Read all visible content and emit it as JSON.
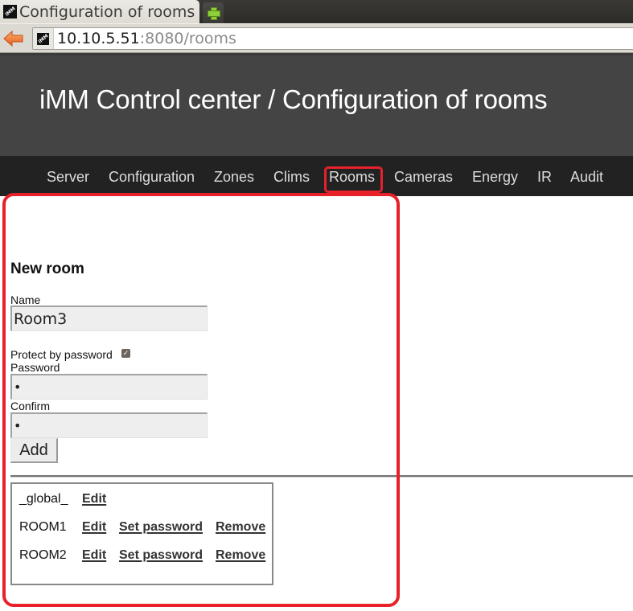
{
  "browser": {
    "tab_title": "Configuration of rooms",
    "favicon_label": "iMM",
    "url_host": "10.10.5.51",
    "url_rest": ":8080/rooms",
    "icons": {
      "back": "back-arrow-icon",
      "new_tab": "plus-icon"
    }
  },
  "header": {
    "title": "iMM Control center / Configuration of rooms"
  },
  "menu": {
    "items": [
      {
        "label": "Server"
      },
      {
        "label": "Configuration"
      },
      {
        "label": "Zones"
      },
      {
        "label": "Clims"
      },
      {
        "label": "Rooms",
        "active": true
      },
      {
        "label": "Cameras"
      },
      {
        "label": "Energy"
      },
      {
        "label": "IR"
      },
      {
        "label": "Audit"
      }
    ]
  },
  "form": {
    "title": "New room",
    "name_label": "Name",
    "name_value": "Room3",
    "protect_label": "Protect by password",
    "protect_checked": true,
    "password_label": "Password",
    "password_value": "•",
    "confirm_label": "Confirm",
    "confirm_value": "•",
    "add_label": "Add"
  },
  "rooms": [
    {
      "name": "_global_",
      "edit": "Edit"
    },
    {
      "name": "ROOM1",
      "edit": "Edit",
      "set_password": "Set password",
      "remove": "Remove"
    },
    {
      "name": "ROOM2",
      "edit": "Edit",
      "set_password": "Set password",
      "remove": "Remove"
    }
  ],
  "colors": {
    "highlight": "#e8202a",
    "header_bg": "#444444",
    "menu_bg": "#222222"
  }
}
